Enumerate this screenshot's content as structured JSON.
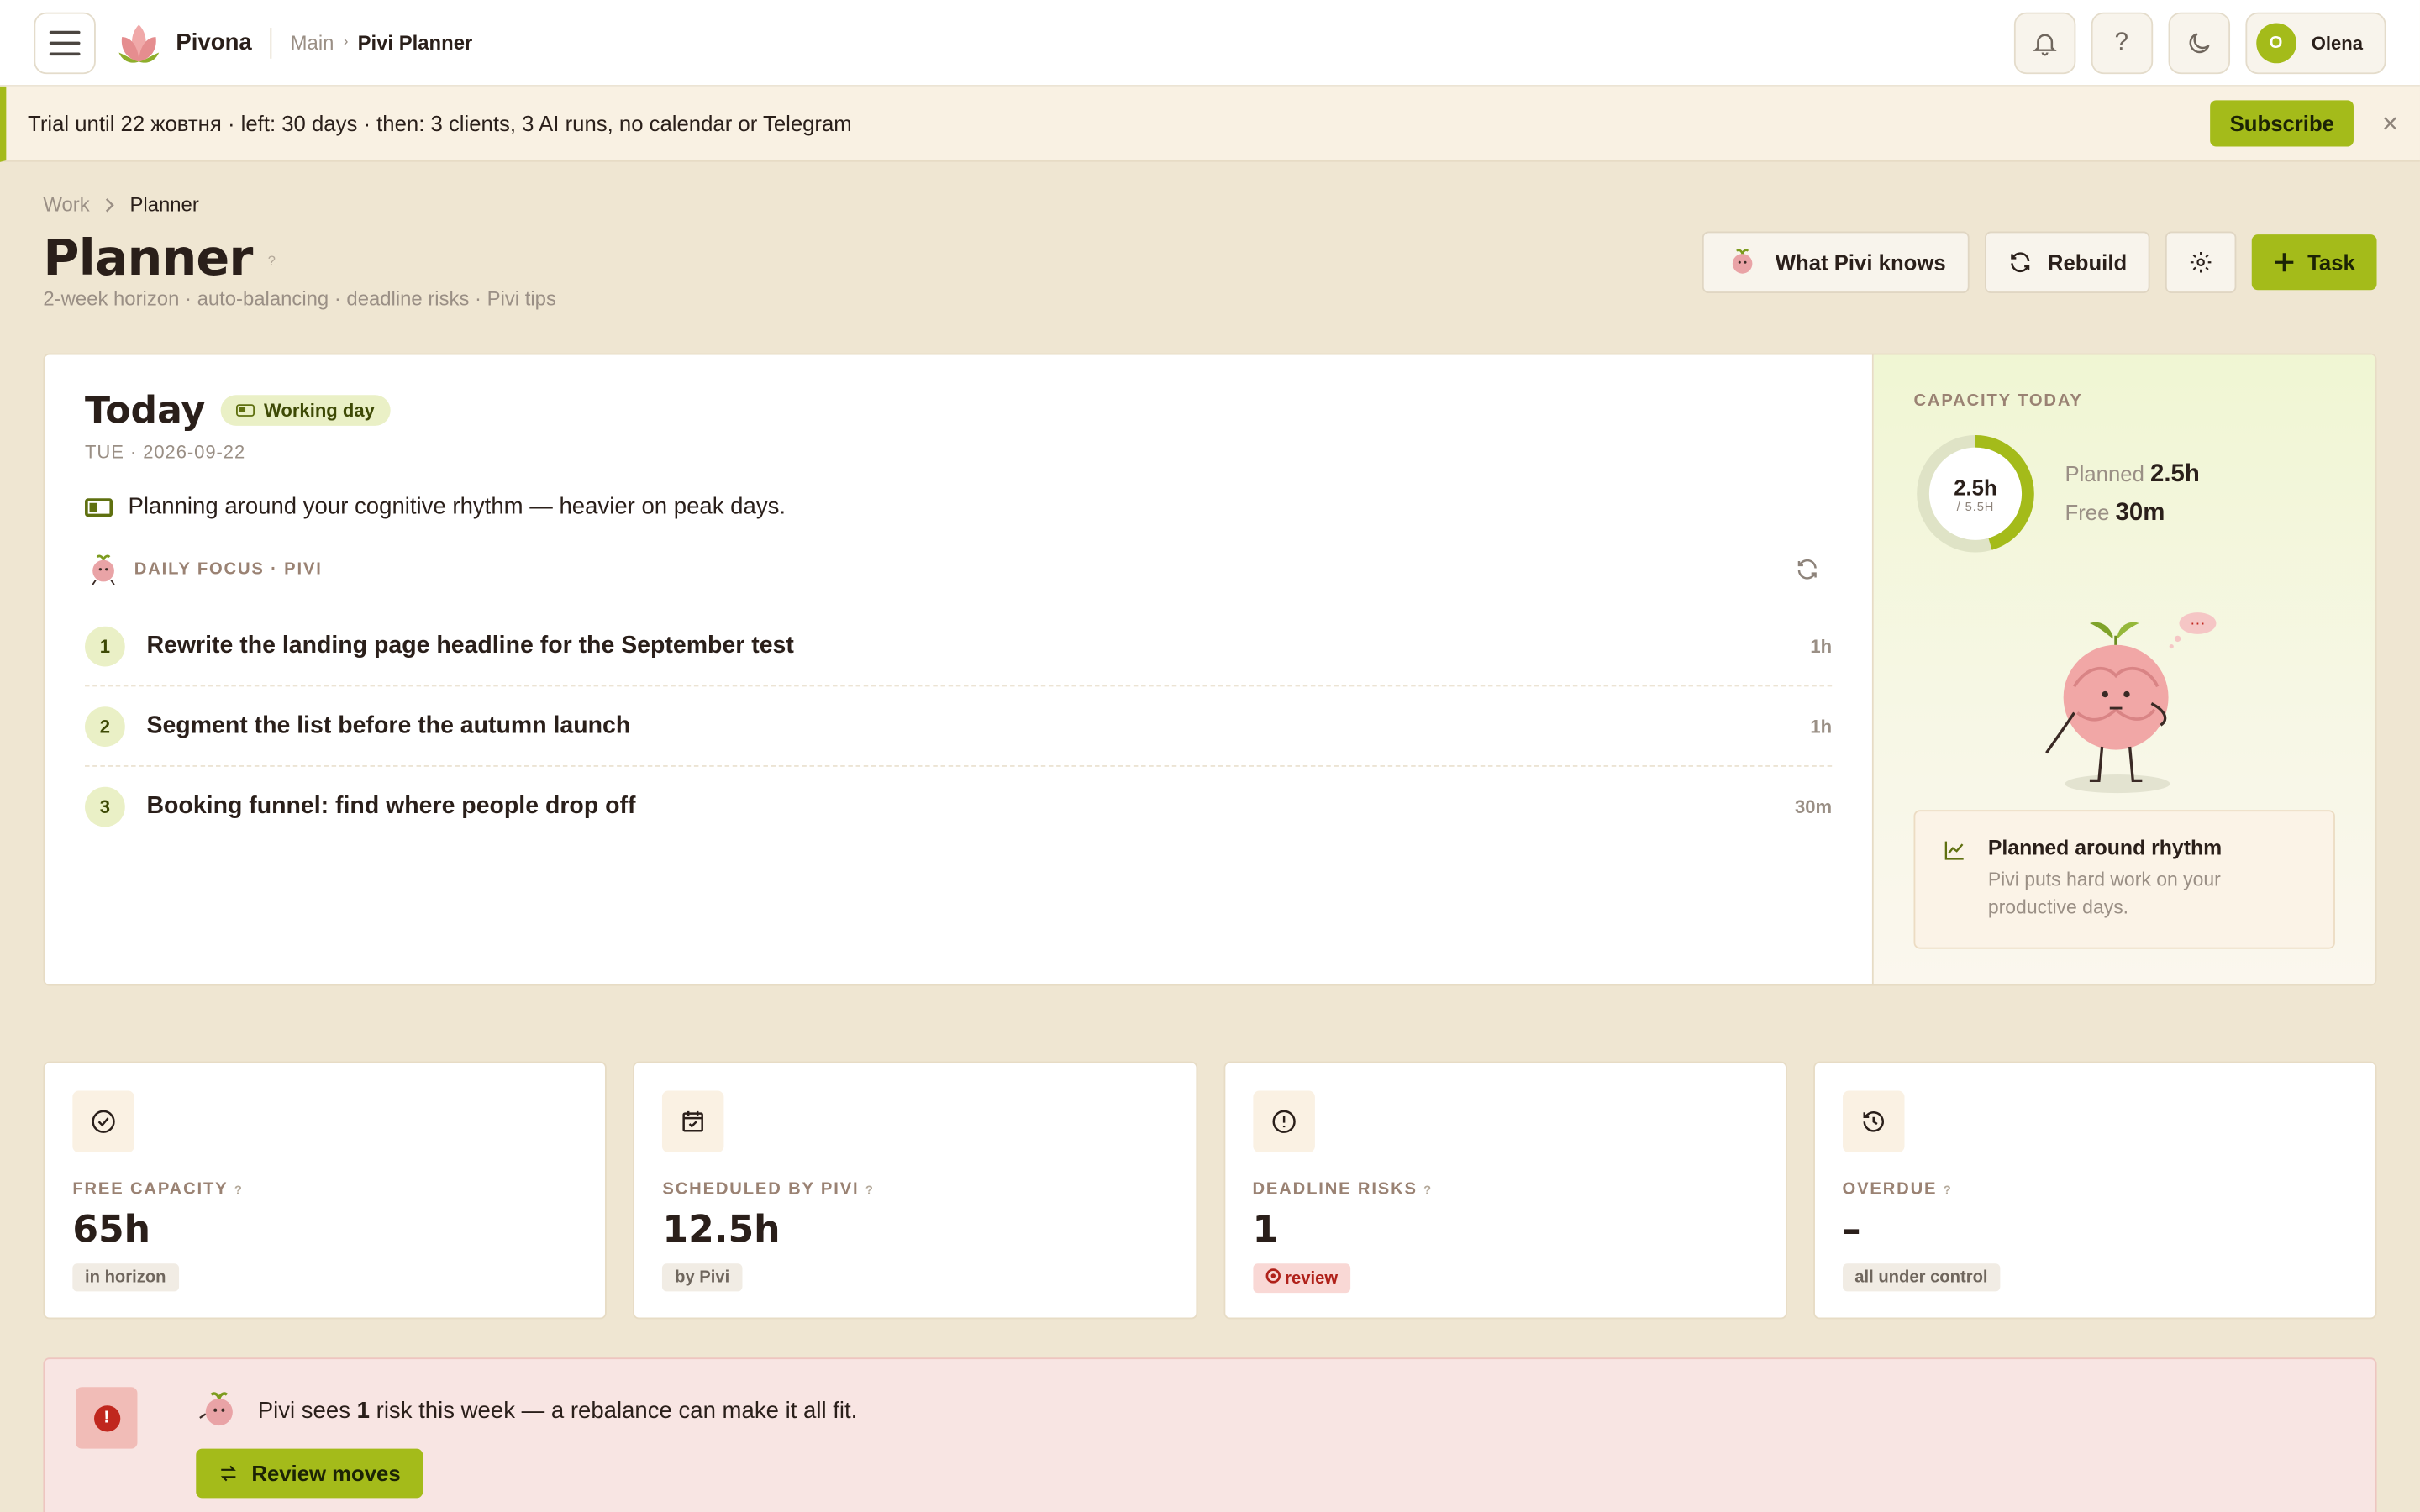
{
  "topbar": {
    "brand": "Pivona",
    "crumb_main": "Main",
    "crumb_current": "Pivi Planner",
    "help_label": "?",
    "user_initial": "O",
    "user_name": "Olena"
  },
  "trial": {
    "text": "Trial until 22 жовтня · left: 30 days · then: 3 clients, 3 AI runs, no calendar or Telegram",
    "subscribe_label": "Subscribe",
    "close_label": "×"
  },
  "page": {
    "breadcrumb_parent": "Work",
    "breadcrumb_current": "Planner",
    "title": "Planner",
    "title_help": "?",
    "subtitle": "2-week horizon · auto-balancing · deadline risks · Pivi tips",
    "actions": {
      "what_pivi_knows": "What Pivi knows",
      "rebuild": "Rebuild",
      "task": "Task"
    }
  },
  "today": {
    "title": "Today",
    "badge": "Working day",
    "date": "TUE · 2026-09-22",
    "rhythm_note": "Planning around your cognitive rhythm — heavier on peak days.",
    "focus_label": "DAILY FOCUS · PIVI",
    "tasks": [
      {
        "num": "1",
        "title": "Rewrite the landing page headline for the September test",
        "duration": "1h"
      },
      {
        "num": "2",
        "title": "Segment the list before the autumn launch",
        "duration": "1h"
      },
      {
        "num": "3",
        "title": "Booking funnel: find where people drop off",
        "duration": "30m"
      }
    ]
  },
  "capacity": {
    "label": "CAPACITY TODAY",
    "ring_main": "2.5h",
    "ring_sub": "/ 5.5H",
    "planned_fraction": 0.4545,
    "planned_label": "Planned",
    "planned_value": "2.5h",
    "free_label": "Free",
    "free_value": "30m",
    "rhythm_title": "Planned around rhythm",
    "rhythm_text": "Pivi puts hard work on your productive days.",
    "mascot_bubble": "···"
  },
  "stats": [
    {
      "label": "FREE CAPACITY",
      "help": "?",
      "value": "65h",
      "tag": "in horizon",
      "icon": "check-circle-icon"
    },
    {
      "label": "SCHEDULED BY PIVI",
      "help": "?",
      "value": "12.5h",
      "tag": "by Pivi",
      "icon": "calendar-check-icon"
    },
    {
      "label": "DEADLINE RISKS",
      "help": "?",
      "value": "1",
      "tag": "review",
      "icon": "alert-circle-icon"
    },
    {
      "label": "OVERDUE",
      "help": "?",
      "value": "–",
      "tag": "all under control",
      "icon": "history-icon"
    }
  ],
  "risk": {
    "prefix": "Pivi sees",
    "count": "1",
    "suffix": "risk this week — a rebalance can make it all fit.",
    "button": "Review moves"
  },
  "colors": {
    "accent": "#a4bb1a",
    "background": "#efe6d2",
    "danger": "#c0271e",
    "ring_track": "#dfe3c6"
  }
}
